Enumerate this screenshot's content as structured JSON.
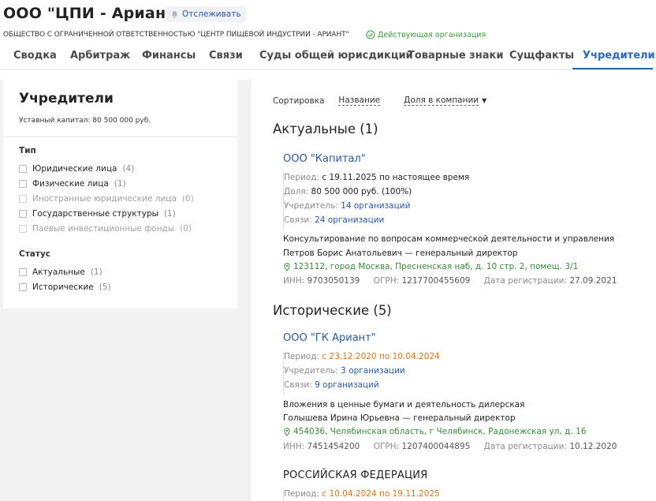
{
  "header": {
    "title": "ООО \"ЦПИ - Ариант\"",
    "follow_label": "Отслеживать",
    "full_name": "ОБЩЕСТВО С ОГРАНИЧЕННОЙ ОТВЕТСТВЕННОСТЬЮ \"ЦЕНТР ПИЩЕВОЙ ИНДУСТРИИ - АРИАНТ\"",
    "status": "Действующая организация"
  },
  "tabs": [
    {
      "label": "Сводка"
    },
    {
      "label": "Арбитраж"
    },
    {
      "label": "Финансы"
    },
    {
      "label": "Связи"
    },
    {
      "label": "Суды общей юрисдикции"
    },
    {
      "label": "Товарные знаки"
    },
    {
      "label": "Сущфакты"
    },
    {
      "label": "Учредители",
      "active": true
    }
  ],
  "filters": {
    "title": "Учредители",
    "capital": "Уставный капитал: 80 500 000 руб.",
    "type_title": "Тип",
    "type_items": [
      {
        "label": "Юридические лица",
        "count": "(4)"
      },
      {
        "label": "Физические лица",
        "count": "(1)"
      },
      {
        "label": "Иностранные юридические лица",
        "count": "(0)"
      },
      {
        "label": "Государственные структуры",
        "count": "(1)"
      },
      {
        "label": "Паевые инвестиционные фонды",
        "count": "(0)"
      }
    ],
    "status_title": "Статус",
    "status_items": [
      {
        "label": "Актуальные",
        "count": "(1)"
      },
      {
        "label": "Исторические",
        "count": "(5)"
      }
    ]
  },
  "main": {
    "sort_label": "Сортировка",
    "sort_name": "Название",
    "sort_share": "Доля в компании",
    "actual_heading": "Актуальные (1)",
    "historic_heading": "Исторические (5)",
    "org1": {
      "name": "ООО \"Капитал\"",
      "period_label": "Период:",
      "period_value": "с 19.11.2025 по настоящее время",
      "share_label": "Доля:",
      "share_value": "80 500 000 руб. (100%)",
      "founder_label": "Учредитель:",
      "founder_value": "14 организаций",
      "links_label": "Связи:",
      "links_value": "24 организации",
      "activity": "Консультирование по вопросам коммерческой деятельности и управления",
      "director": "Петров Борис Анатольевич — генеральный директор",
      "address": "123112, город Москва, Пресненская наб, д. 10 стр. 2, помещ. 3/1",
      "inn_label": "ИНН:",
      "inn": "9703050139",
      "ogrn_label": "ОГРН:",
      "ogrn": "1217700455609",
      "reg_label": "Дата регистрации:",
      "reg": "27.09.2021"
    },
    "org2": {
      "name": "ООО \"ГК Ариант\"",
      "period_label": "Период:",
      "period_value": "с 23.12.2020 по 10.04.2024",
      "founder_label": "Учредитель:",
      "founder_value": "3 организации",
      "links_label": "Связи:",
      "links_value": "9 организаций",
      "activity": "Вложения в ценные бумаги и деятельность дилерская",
      "director": "Голышева Ирина Юрьевна — генеральный директор",
      "address": "454036, Челябинская область, г Челябинск, Радонежская ул, д. 16",
      "inn_label": "ИНН:",
      "inn": "7451454200",
      "ogrn_label": "ОГРН:",
      "ogrn": "1207400044895",
      "reg_label": "Дата регистрации:",
      "reg": "10.12.2020"
    },
    "org3": {
      "name": "РОССИЙСКАЯ ФЕДЕРАЦИЯ",
      "period_label": "Период:",
      "period_value": "с 10.04.2024 по 19.11.2025"
    }
  },
  "colors": {
    "accent": "#2a6ab8",
    "link": "#2a5a9c",
    "active_status": "#3a9a3a",
    "address": "#3a8a3a",
    "historic_period": "#d9741b"
  },
  "icons": {
    "follow": "bell-icon",
    "status": "check-circle-icon",
    "address": "map-pin-icon",
    "sort_direction": "caret-down-icon"
  }
}
